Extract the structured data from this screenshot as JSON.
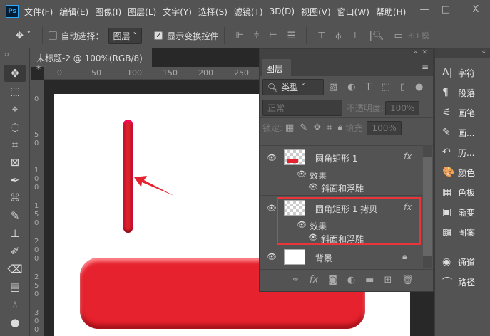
{
  "app": {
    "logo": "Ps"
  },
  "menu": [
    "文件(F)",
    "编辑(E)",
    "图像(I)",
    "图层(L)",
    "文字(Y)",
    "选择(S)",
    "滤镜(T)",
    "3D(D)",
    "视图(V)",
    "窗口(W)",
    "帮助(H)"
  ],
  "window_controls": {
    "minimize": "—",
    "maximize": "□",
    "close": "X"
  },
  "options": {
    "auto_select_label": "自动选择：",
    "auto_select_checked": false,
    "auto_select_target": "图层",
    "show_transform_label": "显示变换控件",
    "show_transform_checked": true,
    "mode_3d": "3D 模"
  },
  "document": {
    "tab_title": "未标题-2 @ 100%(RGB/8) *",
    "ruler_top": [
      "0",
      "50",
      "100",
      "150",
      "200",
      "250"
    ],
    "ruler_left": [
      "0",
      "50",
      "100",
      "150",
      "200",
      "250",
      "300"
    ]
  },
  "layers_panel": {
    "title": "图层",
    "filter_kind": "类型",
    "blend_mode": "正常",
    "opacity_label": "不透明度:",
    "opacity": "100%",
    "lock_label": "锁定:",
    "fill_label": "填充:",
    "fill": "100%",
    "layers": [
      {
        "name": "圆角矩形 1",
        "fx": "fx",
        "effects_label": "效果",
        "effect": "斜面和浮雕",
        "visible": true
      },
      {
        "name": "圆角矩形 1 拷贝",
        "fx": "fx",
        "effects_label": "效果",
        "effect": "斜面和浮雕",
        "visible": true,
        "highlighted": true
      },
      {
        "name": "背景",
        "locked": true,
        "visible": true
      }
    ]
  },
  "right_panels": [
    {
      "icon": "character-icon",
      "glyph": "A|",
      "label": "字符"
    },
    {
      "icon": "paragraph-icon",
      "glyph": "¶",
      "label": "段落"
    },
    {
      "icon": "brush-settings-icon",
      "glyph": "⚟",
      "label": "画笔"
    },
    {
      "icon": "brushes-icon",
      "glyph": "✎",
      "label": "画..."
    },
    {
      "icon": "history-icon",
      "glyph": "↶",
      "label": "历..."
    },
    {
      "icon": "color-icon",
      "glyph": "🎨",
      "label": "颜色"
    },
    {
      "icon": "swatches-icon",
      "glyph": "▦",
      "label": "色板"
    },
    {
      "icon": "gradient-icon",
      "glyph": "▣",
      "label": "渐变"
    },
    {
      "icon": "patterns-icon",
      "glyph": "▩",
      "label": "图案"
    },
    {
      "icon": "channels-icon",
      "glyph": "◉",
      "label": "通道"
    },
    {
      "icon": "paths-icon",
      "glyph": "⌒",
      "label": "路径"
    }
  ],
  "colors": {
    "accent_red": "#e5222d",
    "highlight_box": "#e8343a",
    "ui_bg": "#535353"
  }
}
